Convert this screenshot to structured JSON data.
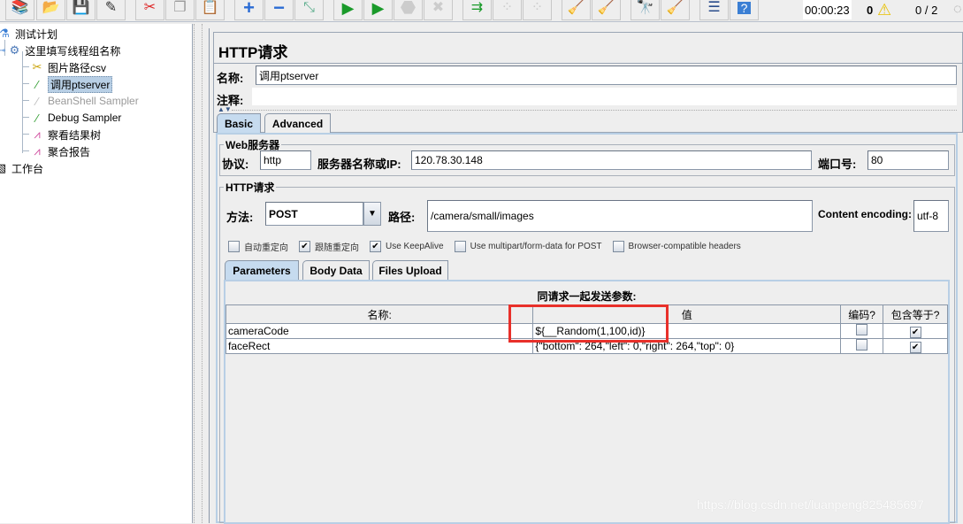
{
  "toolbar": {
    "buttons": [
      {
        "name": "templates-button",
        "icon": "templates-icon",
        "glyph": "📚"
      },
      {
        "name": "open-button",
        "icon": "folder-icon",
        "glyph": "📂"
      },
      {
        "name": "save-button",
        "icon": "floppy-icon",
        "glyph": "💾"
      },
      {
        "name": "save-as-button",
        "icon": "edit-icon",
        "glyph": "✎"
      },
      {
        "name": "cut-button",
        "icon": "scissors-icon",
        "glyph": "✂"
      },
      {
        "name": "copy-button",
        "icon": "copy-icon",
        "glyph": "❐"
      },
      {
        "name": "paste-button",
        "icon": "clipboard-icon",
        "glyph": "📋"
      },
      {
        "name": "expand-button",
        "icon": "plus-icon",
        "glyph": "+"
      },
      {
        "name": "collapse-button",
        "icon": "minus-icon",
        "glyph": "−"
      },
      {
        "name": "toggle-button",
        "icon": "toggle-icon",
        "glyph": "⤡"
      },
      {
        "name": "start-button",
        "icon": "play-icon",
        "glyph": "▶"
      },
      {
        "name": "start-no-pauses-button",
        "icon": "play-no-timer-icon",
        "glyph": "▶"
      },
      {
        "name": "stop-button",
        "icon": "stop-icon",
        "glyph": "⬣"
      },
      {
        "name": "shutdown-button",
        "icon": "shutdown-icon",
        "glyph": "✖"
      },
      {
        "name": "remote-start-button",
        "icon": "remote-start-icon",
        "glyph": "⇉"
      },
      {
        "name": "remote-stop-button",
        "icon": "remote-stop-icon",
        "glyph": "⁘"
      },
      {
        "name": "remote-shutdown-button",
        "icon": "remote-shutdown-icon",
        "glyph": "⁘"
      },
      {
        "name": "clear-button",
        "icon": "clear-icon",
        "glyph": "🧹"
      },
      {
        "name": "clear-all-button",
        "icon": "clear-all-icon",
        "glyph": "🧹"
      },
      {
        "name": "search-button",
        "icon": "binoculars-icon",
        "glyph": "🔭"
      },
      {
        "name": "reset-search-button",
        "icon": "broom-icon",
        "glyph": "🧹"
      },
      {
        "name": "function-helper-button",
        "icon": "list-icon",
        "glyph": "☰"
      },
      {
        "name": "help-button",
        "icon": "help-icon",
        "glyph": "?"
      }
    ],
    "timer": "00:00:23",
    "warnings_count": "0",
    "threads": "0 / 2"
  },
  "tree": {
    "items": [
      {
        "label": "测试计划",
        "icon": "test-plan-icon"
      },
      {
        "label": "这里填写线程组名称",
        "icon": "thread-group-gear-icon"
      },
      {
        "label": "图片路径csv",
        "icon": "config-tools-icon"
      },
      {
        "label": "调用ptserver",
        "icon": "sampler-pipette-icon",
        "selected": true
      },
      {
        "label": "BeanShell Sampler",
        "icon": "sampler-pipette-icon",
        "disabled": true
      },
      {
        "label": "Debug Sampler",
        "icon": "sampler-pipette-icon"
      },
      {
        "label": "察看结果树",
        "icon": "listener-graph-icon"
      },
      {
        "label": "聚合报告",
        "icon": "listener-graph-icon"
      },
      {
        "label": "工作台",
        "icon": "workbench-icon"
      }
    ]
  },
  "panel": {
    "title": "HTTP请求",
    "name_label": "名称:",
    "name_value": "调用ptserver",
    "comment_label": "注释:",
    "comment_value": "",
    "tabs": [
      {
        "label": "Basic",
        "active": true
      },
      {
        "label": "Advanced",
        "active": false
      }
    ],
    "web_server": {
      "group_title": "Web服务器",
      "protocol_label": "协议:",
      "protocol_value": "http",
      "server_label": "服务器名称或IP:",
      "server_value": "120.78.30.148",
      "port_label": "端口号:",
      "port_value": "80"
    },
    "http_request": {
      "group_title": "HTTP请求",
      "method_label": "方法:",
      "method_value": "POST",
      "path_label": "路径:",
      "path_value": "/camera/small/images",
      "encoding_label": "Content encoding:",
      "encoding_value": "utf-8",
      "checkboxes": [
        {
          "label": "自动重定向",
          "checked": false
        },
        {
          "label": "跟随重定向",
          "checked": true
        },
        {
          "label": "Use KeepAlive",
          "checked": true
        },
        {
          "label": "Use multipart/form-data for POST",
          "checked": false
        },
        {
          "label": "Browser-compatible headers",
          "checked": false
        }
      ]
    },
    "sub_tabs": [
      {
        "label": "Parameters",
        "active": true
      },
      {
        "label": "Body Data",
        "active": false
      },
      {
        "label": "Files Upload",
        "active": false
      }
    ],
    "params": {
      "caption": "同请求一起发送参数:",
      "headers": [
        "名称:",
        "值",
        "编码?",
        "包含等于?"
      ],
      "rows": [
        {
          "name": "cameraCode",
          "value": "${__Random(1,100,id)}",
          "encode": false,
          "include_equals": true
        },
        {
          "name": "faceRect",
          "value": "{\"bottom\": 264,\"left\": 0,\"right\": 264,\"top\": 0}",
          "encode": false,
          "include_equals": true
        }
      ]
    }
  },
  "watermark": "https://blog.csdn.net/luanpeng825485697",
  "check_glyph": "✔",
  "colors": {
    "selection": "#b8cfe5",
    "highlight_box": "#e8302a",
    "active_tab": "#c6dbef"
  }
}
